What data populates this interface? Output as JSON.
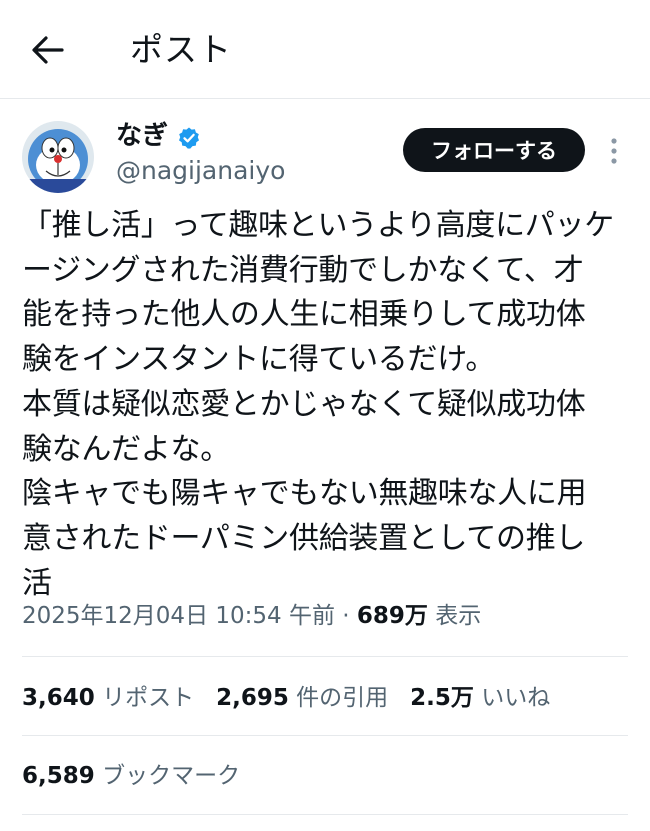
{
  "header": {
    "back_icon": "arrow-left-icon",
    "title": "ポスト"
  },
  "author": {
    "display_name": "なぎ",
    "handle": "@nagijanaiyo",
    "verified_color": "#1d9bf0",
    "avatar_icon": "robot-cat-avatar"
  },
  "follow_button": {
    "label": "フォローする"
  },
  "more_icon": "vertical-ellipsis-icon",
  "tweet": {
    "lines": [
      "「推し活」って趣味というより高度にパッケ",
      "ージングされた消費行動でしかなくて、才",
      "能を持った他人の人生に相乗りして成功体",
      "験をインスタントに得ているだけ。",
      "本質は疑似恋愛とかじゃなくて疑似成功体",
      "験なんだよな。",
      "陰キャでも陽キャでもない無趣味な人に用",
      "意されたドーパミン供給装置としての推し",
      "活"
    ]
  },
  "meta": {
    "timestamp": "2025年12月04日 10:54 午前",
    "separator": " · ",
    "views_count": "689万",
    "views_label": "表示"
  },
  "stats": {
    "reposts_count": "3,640",
    "reposts_label": "リポスト",
    "quotes_count": "2,695",
    "quotes_label": "件の引用",
    "likes_count": "2.5万",
    "likes_label": "いいね",
    "bookmarks_count": "6,589",
    "bookmarks_label": "ブックマーク"
  }
}
